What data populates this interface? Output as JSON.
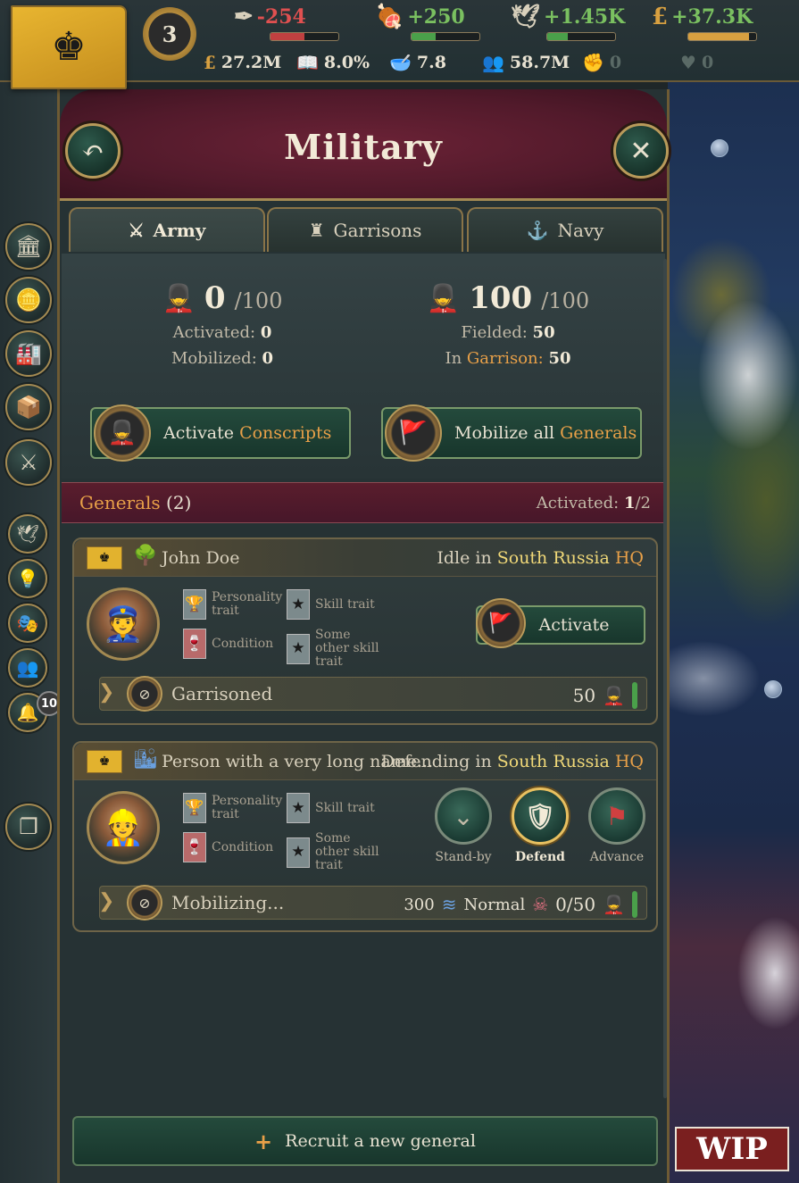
{
  "topbar": {
    "level": "3",
    "resources": [
      {
        "icon": "quill-icon",
        "value": "-254",
        "color": "#e05050",
        "fill": 0.5,
        "fill_color": "#c04040"
      },
      {
        "icon": "meat-icon",
        "value": "+250",
        "color": "#7ac060",
        "fill": 0.35,
        "fill_color": "#4aa04a"
      },
      {
        "icon": "dove-icon",
        "value": "+1.45K",
        "color": "#7ac060",
        "fill": 0.3,
        "fill_color": "#4aa04a"
      },
      {
        "icon": "pound-icon",
        "value": "+37.3K",
        "color": "#7ac060",
        "fill": 0.9,
        "fill_color": "#d8a040"
      }
    ],
    "stats": [
      {
        "icon": "treasury-icon",
        "value": "27.2M"
      },
      {
        "icon": "book-icon",
        "value": "8.0%"
      },
      {
        "icon": "bowl-icon",
        "value": "7.8"
      },
      {
        "icon": "population-icon",
        "value": "58.7M"
      },
      {
        "icon": "fist-icon",
        "value": "0"
      },
      {
        "icon": "heart-icon",
        "value": "0"
      }
    ]
  },
  "nav": {
    "notification_count": "10"
  },
  "panel": {
    "title": "Military",
    "tabs": [
      "Army",
      "Garrisons",
      "Navy"
    ],
    "conscripts": {
      "current": "0",
      "max": "/100",
      "activated_label": "Activated:",
      "activated": "0",
      "mobilized_label": "Mobilized:",
      "mobilized": "0"
    },
    "regulars": {
      "current": "100",
      "max": "/100",
      "fielded_label": "Fielded:",
      "fielded": "50",
      "garrison_prefix": "In",
      "garrison_word": "Garrison:",
      "garrison": "50"
    },
    "activate_btn": {
      "prefix": "Activate",
      "highlight": "Conscripts"
    },
    "mobilize_btn": {
      "prefix": "Mobilize all",
      "highlight": "Generals"
    },
    "generals_header": {
      "label": "Generals",
      "count": "(2)",
      "activated_label": "Activated:",
      "activated": "1",
      "total": "/2"
    },
    "generals": [
      {
        "name": "John Doe",
        "status_prefix": "Idle in",
        "location": "South Russia",
        "hq": "HQ",
        "traits": {
          "personality": "Personality trait",
          "skill": "Skill trait",
          "condition": "Condition",
          "other": "Some other skill trait"
        },
        "action": "Activate",
        "footer_label": "Garrisoned",
        "footer_count": "50"
      },
      {
        "name": "Person with a very long name...",
        "status_prefix": "Defending in",
        "location": "South Russia",
        "hq": "HQ",
        "traits": {
          "personality": "Personality trait",
          "skill": "Skill trait",
          "condition": "Condition",
          "other": "Some other skill trait"
        },
        "stances": [
          "Stand-by",
          "Defend",
          "Advance"
        ],
        "footer_label": "Mobilizing...",
        "footer_supply": "300",
        "footer_mode": "Normal",
        "footer_count": "0/50"
      }
    ],
    "recruit": "Recruit a new general"
  },
  "wip": "WIP"
}
